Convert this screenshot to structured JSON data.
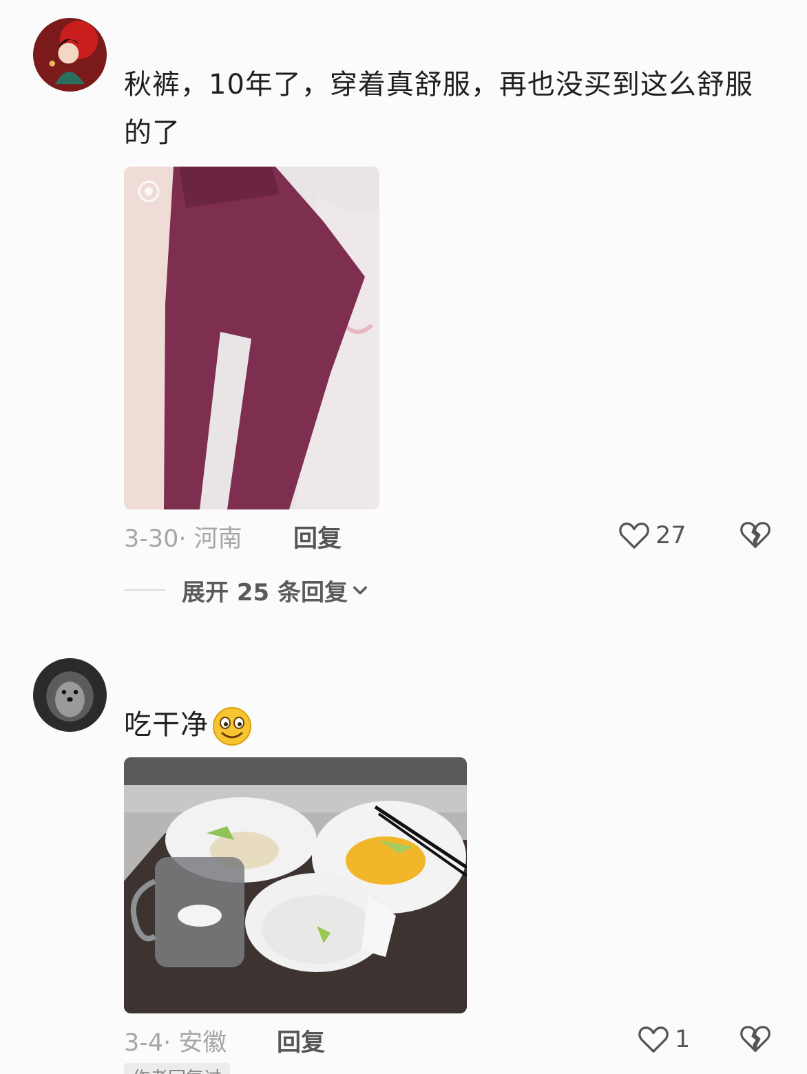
{
  "comments": [
    {
      "text": "秋裤，10年了，穿着真舒服，再也没买到这么舒服的了",
      "date_location": "3-30· 河南",
      "reply_label": "回复",
      "likes": "27",
      "expand_label": "展开 25 条回复",
      "avatar_icon": "girl-illustration-avatar",
      "photo_icon": "maroon-long-johns-photo"
    },
    {
      "username": "",
      "text": "吃干净",
      "emoji": "smile-emoji",
      "date_location": "3-4· 安徽",
      "reply_label": "回复",
      "likes": "1",
      "author_badge": "作者回复过",
      "avatar_icon": "dog-avatar",
      "photo_icon": "empty-plates-photo"
    }
  ],
  "colors": {
    "background": "#fbfbfb",
    "meta_text": "#a6a6a6",
    "text": "#1f1f1f"
  }
}
